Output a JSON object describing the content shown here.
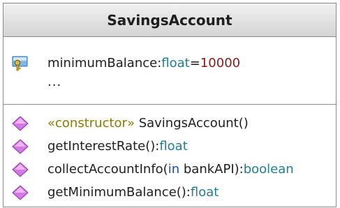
{
  "class": {
    "name": "SavingsAccount"
  },
  "attributes": [
    {
      "name": "minimumBalance",
      "sep": ":",
      "type": "float",
      "eq": "=",
      "default": "10000"
    }
  ],
  "attributes_more": "...",
  "operations": [
    {
      "stereotype": "«constructor»",
      "name": " SavingsAccount()",
      "type": ""
    },
    {
      "name": "getInterestRate():",
      "type": "float"
    },
    {
      "name": "collectAccountInfo(",
      "dir": "in",
      "param": " bankAPI):",
      "type": "boolean"
    },
    {
      "name": "getMinimumBalance():",
      "type": "float"
    }
  ],
  "colors": {
    "type": "#1f7f93",
    "default_value": "#8b1a1a",
    "stereotype": "#8a7a00",
    "direction": "#1f4fb3",
    "operation_icon": "#c060d8",
    "attribute_icon": "#3a7fbf"
  },
  "icons": {
    "attribute": "protected-attribute-key-icon",
    "operation": "public-operation-diamond-icon"
  }
}
